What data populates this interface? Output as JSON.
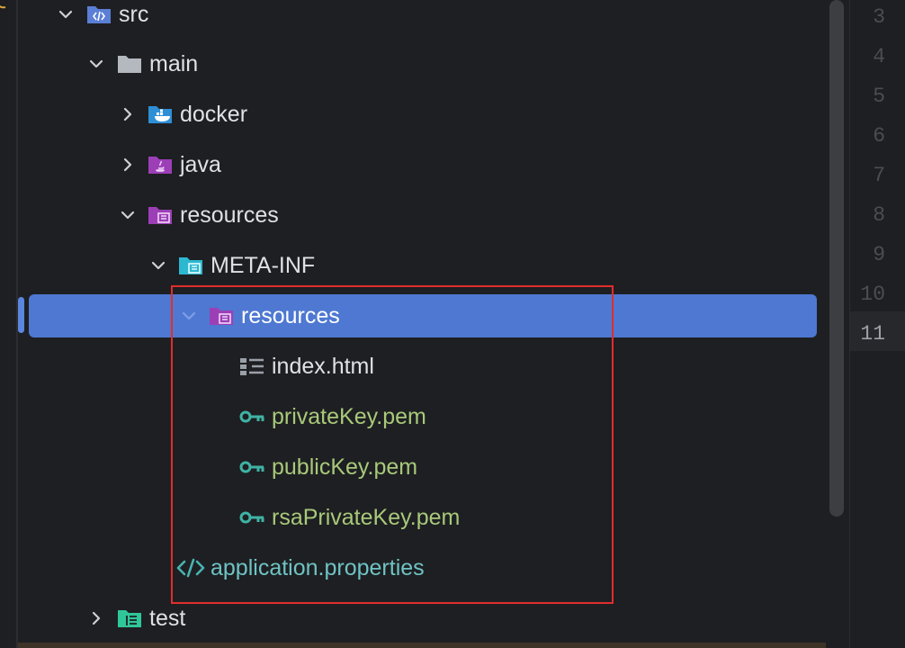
{
  "tree": {
    "items": [
      {
        "label": "src",
        "expanded": true,
        "icon": "source-folder-icon"
      },
      {
        "label": "main",
        "expanded": true,
        "icon": "folder-icon"
      },
      {
        "label": "docker",
        "expanded": false,
        "icon": "docker-folder-icon"
      },
      {
        "label": "java",
        "expanded": false,
        "icon": "java-folder-icon"
      },
      {
        "label": "resources",
        "expanded": true,
        "icon": "resources-folder-icon"
      },
      {
        "label": "META-INF",
        "expanded": true,
        "icon": "meta-inf-folder-icon"
      },
      {
        "label": "resources",
        "expanded": true,
        "selected": true,
        "icon": "resources-folder-icon"
      },
      {
        "label": "index.html",
        "icon": "html-file-icon"
      },
      {
        "label": "privateKey.pem",
        "icon": "key-icon"
      },
      {
        "label": "publicKey.pem",
        "icon": "key-icon"
      },
      {
        "label": "rsaPrivateKey.pem",
        "icon": "key-icon"
      },
      {
        "label": "application.properties",
        "icon": "properties-file-icon"
      },
      {
        "label": "test",
        "expanded": false,
        "icon": "test-folder-icon"
      }
    ]
  },
  "gutter": {
    "line_numbers": [
      "3",
      "4",
      "5",
      "6",
      "7",
      "8",
      "9",
      "10",
      "11"
    ],
    "current_line": "11"
  },
  "colors": {
    "selection": "#4e78d1",
    "highlight_box": "#e02d2d",
    "vcs_added_text": "#a8c97a",
    "properties_text": "#6fc3c4"
  }
}
